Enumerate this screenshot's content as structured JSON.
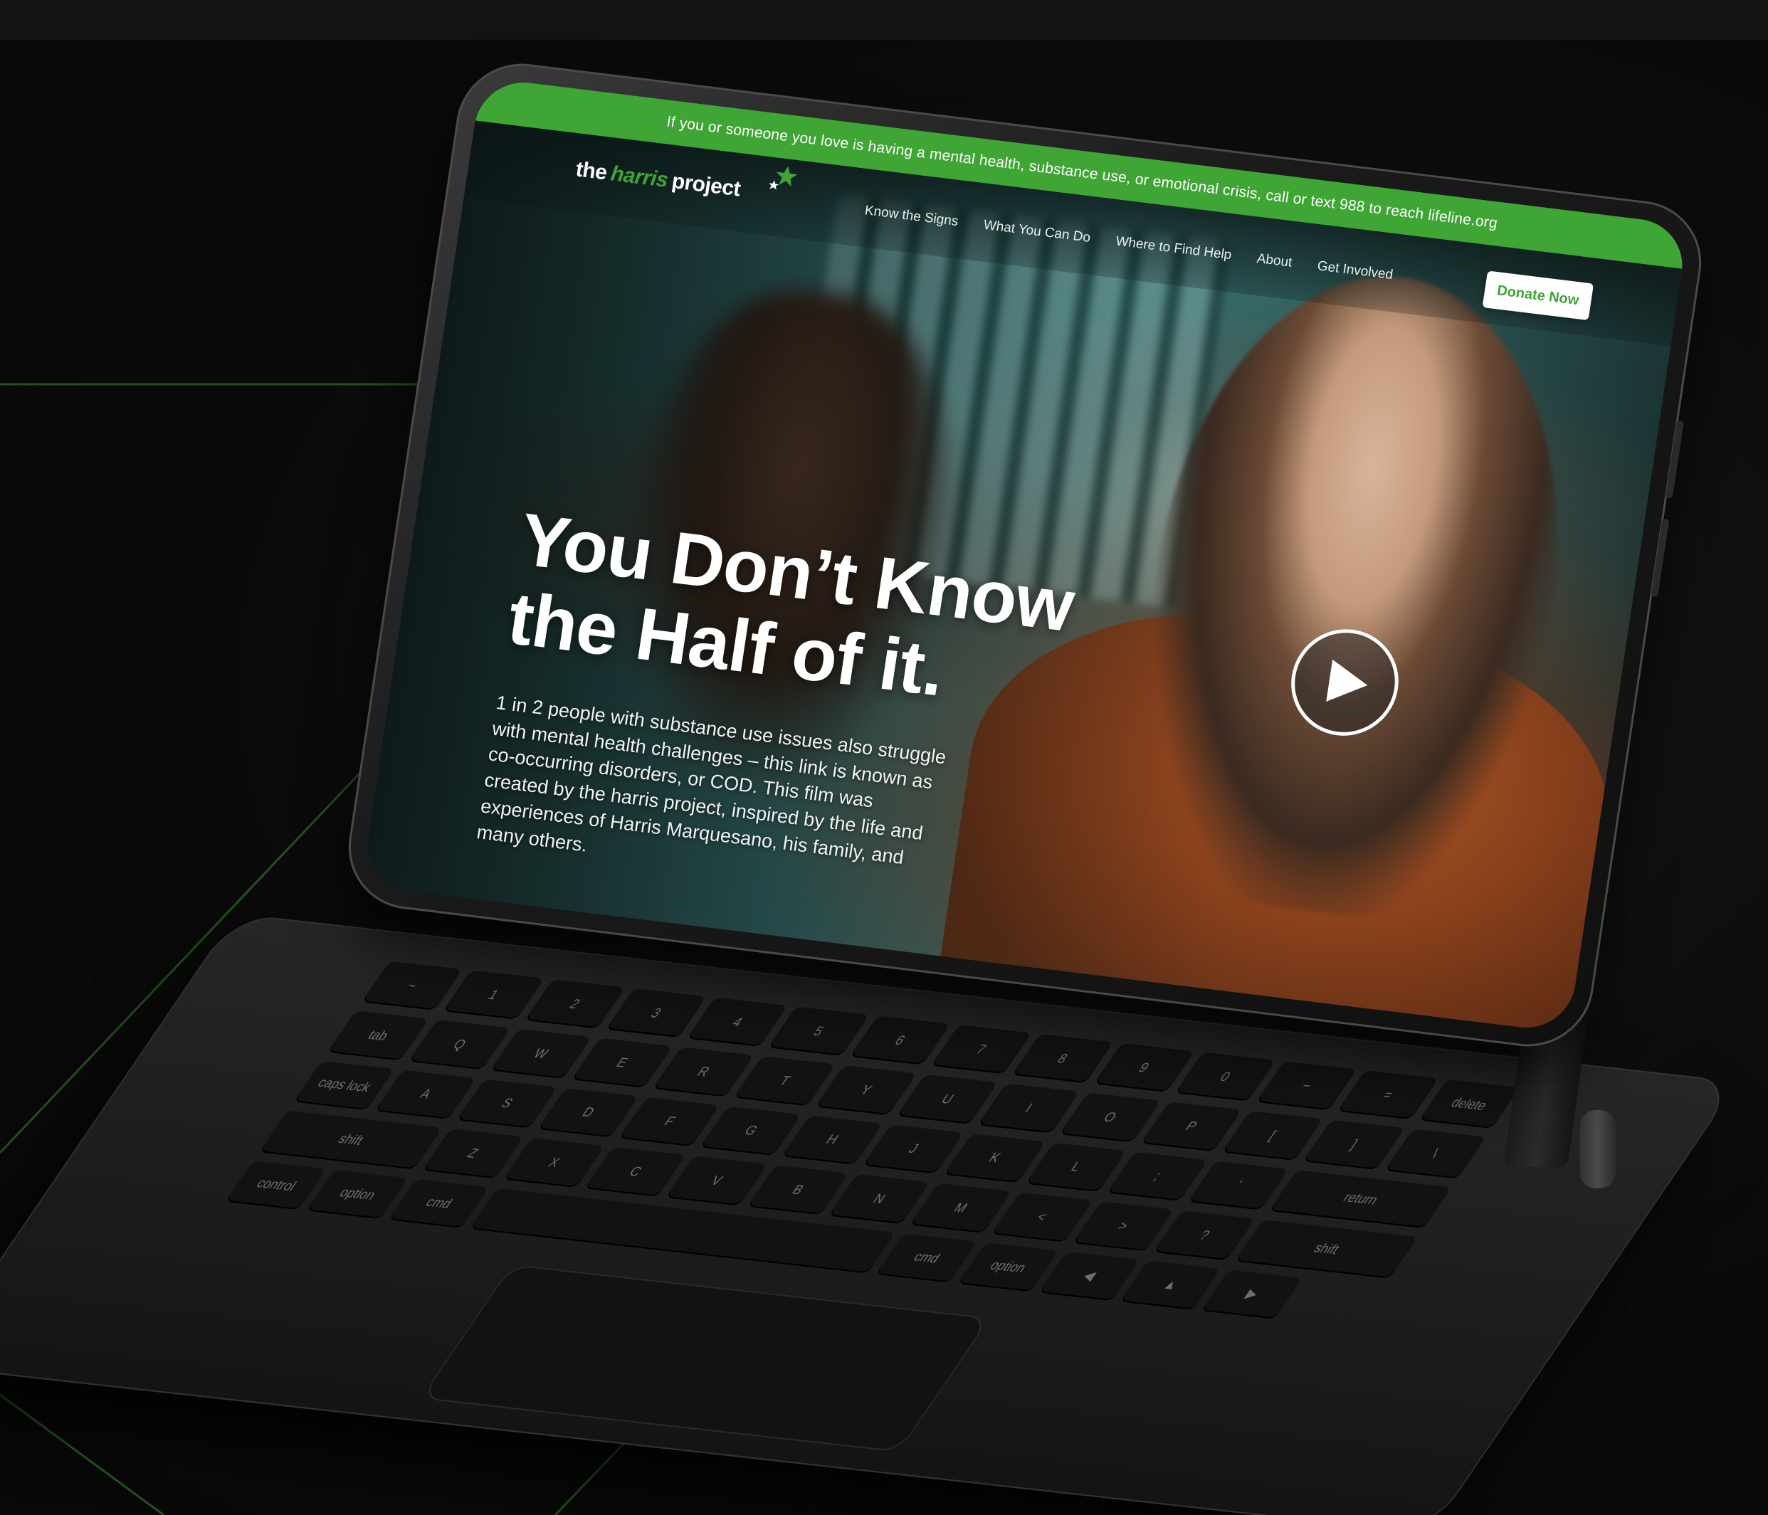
{
  "banner": {
    "text": "If you or someone you love is having a mental health, substance use, or emotional crisis, call or text 988 to reach lifeline.org"
  },
  "logo": {
    "part1": "the",
    "part2": "harris",
    "part3": "project"
  },
  "nav": {
    "items": [
      {
        "label": "Know the Signs"
      },
      {
        "label": "What You Can Do"
      },
      {
        "label": "Where to Find Help"
      },
      {
        "label": "About"
      },
      {
        "label": "Get Involved"
      }
    ],
    "donate_label": "Donate Now"
  },
  "hero": {
    "title_line1": "You Don’t Know",
    "title_line2": "the Half of it.",
    "body": "1 in 2 people with substance use issues also struggle with mental health challenges – this link is known as co-occurring disorders, or COD. This film was created by the harris project, inspired by the life and experiences of Harris Marquesano, his family, and many others."
  },
  "keyboard": {
    "rows": [
      [
        "~",
        "1",
        "2",
        "3",
        "4",
        "5",
        "6",
        "7",
        "8",
        "9",
        "0",
        "−",
        "=",
        "delete"
      ],
      [
        "tab",
        "Q",
        "W",
        "E",
        "R",
        "T",
        "Y",
        "U",
        "I",
        "O",
        "P",
        "[",
        "]",
        "\\"
      ],
      [
        "caps lock",
        "A",
        "S",
        "D",
        "F",
        "G",
        "H",
        "J",
        "K",
        "L",
        ";",
        "'",
        "return"
      ],
      [
        "shift",
        "Z",
        "X",
        "C",
        "V",
        "B",
        "N",
        "M",
        "<",
        ">",
        "?",
        "shift"
      ],
      [
        "control",
        "option",
        "cmd",
        "",
        "cmd",
        "option",
        "◀",
        "▲",
        "▶"
      ]
    ]
  },
  "colors": {
    "brand_green": "#3fa535",
    "background": "#0b0b0b",
    "accent_line": "#2f6b2a"
  }
}
